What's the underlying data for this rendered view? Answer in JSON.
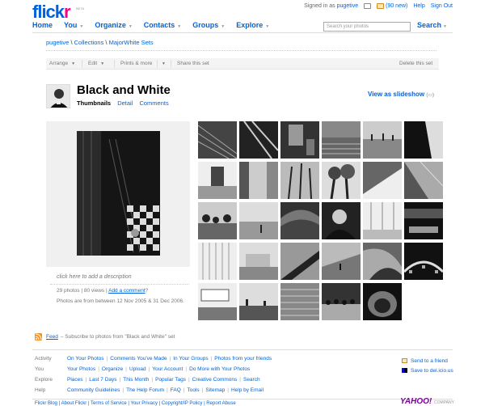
{
  "brand": {
    "logo_blue": "flick",
    "logo_pink": "r",
    "beta": "BETA"
  },
  "colors": {
    "brand_blue": "#0063dc",
    "brand_pink": "#ff0084"
  },
  "topbar": {
    "signed_in_prefix": "Signed in as",
    "username": "pugetive",
    "new_mail": "(90 new)",
    "help": "Help",
    "sign_out": "Sign Out",
    "icons": [
      "cart-icon",
      "mail-icon"
    ]
  },
  "nav": {
    "items": [
      "Home",
      "You",
      "Organize",
      "Contacts",
      "Groups",
      "Explore"
    ],
    "search_placeholder": "Search your photos",
    "search_label": "Search"
  },
  "breadcrumb": {
    "user": "pugetive",
    "sep": "\\",
    "collections": "Collections",
    "current": "MajorWhite Sets"
  },
  "actionbar": {
    "arrange": "Arrange",
    "edit": "Edit",
    "prints": "Prints & more",
    "share": "Share this set",
    "delete": "Delete this set"
  },
  "set": {
    "title": "Black and White",
    "view_current": "Thumbnails",
    "view_detail": "Detail",
    "view_comments": "Comments",
    "slideshow": "View as slideshow",
    "description_prompt": "click here to add a description",
    "photo_count": "29 photos",
    "views": "| 80 views |",
    "add_comment": "Add a comment",
    "question": "?",
    "dates": "Photos are from between 12 Nov 2005 & 31 Dec 2006."
  },
  "thumbnails": {
    "rows": 5,
    "columns": 6,
    "count": 29
  },
  "feed": {
    "label": "Feed",
    "text": "– Subscribe to photos from \"Black and White\" set"
  },
  "footer": {
    "rows": [
      {
        "label": "Activity",
        "links": [
          "On Your Photos",
          "Comments You've Made",
          "In Your Groups",
          "Photos from your friends"
        ]
      },
      {
        "label": "You",
        "links": [
          "Your Photos",
          "Organize",
          "Upload",
          "Your Account",
          "Do More with Your Photos"
        ]
      },
      {
        "label": "Explore",
        "links": [
          "Places",
          "Last 7 Days",
          "This Month",
          "Popular Tags",
          "Creative Commons",
          "Search"
        ]
      },
      {
        "label": "Help",
        "links": [
          "Community Guidelines",
          "The Help Forum",
          "FAQ",
          "Tools",
          "Sitemap",
          "Help by Email"
        ]
      }
    ],
    "send_friend": "Send to a friend",
    "delicious": "Save to del.icio.us",
    "bottom": "Flickr Blog  |  About Flickr  |  Terms of Service  |  Your Privacy  |  Copyright/IP Policy  |  Report Abuse",
    "yahoo": "YAHOO!",
    "yahoo_sub": "COMPANY"
  }
}
